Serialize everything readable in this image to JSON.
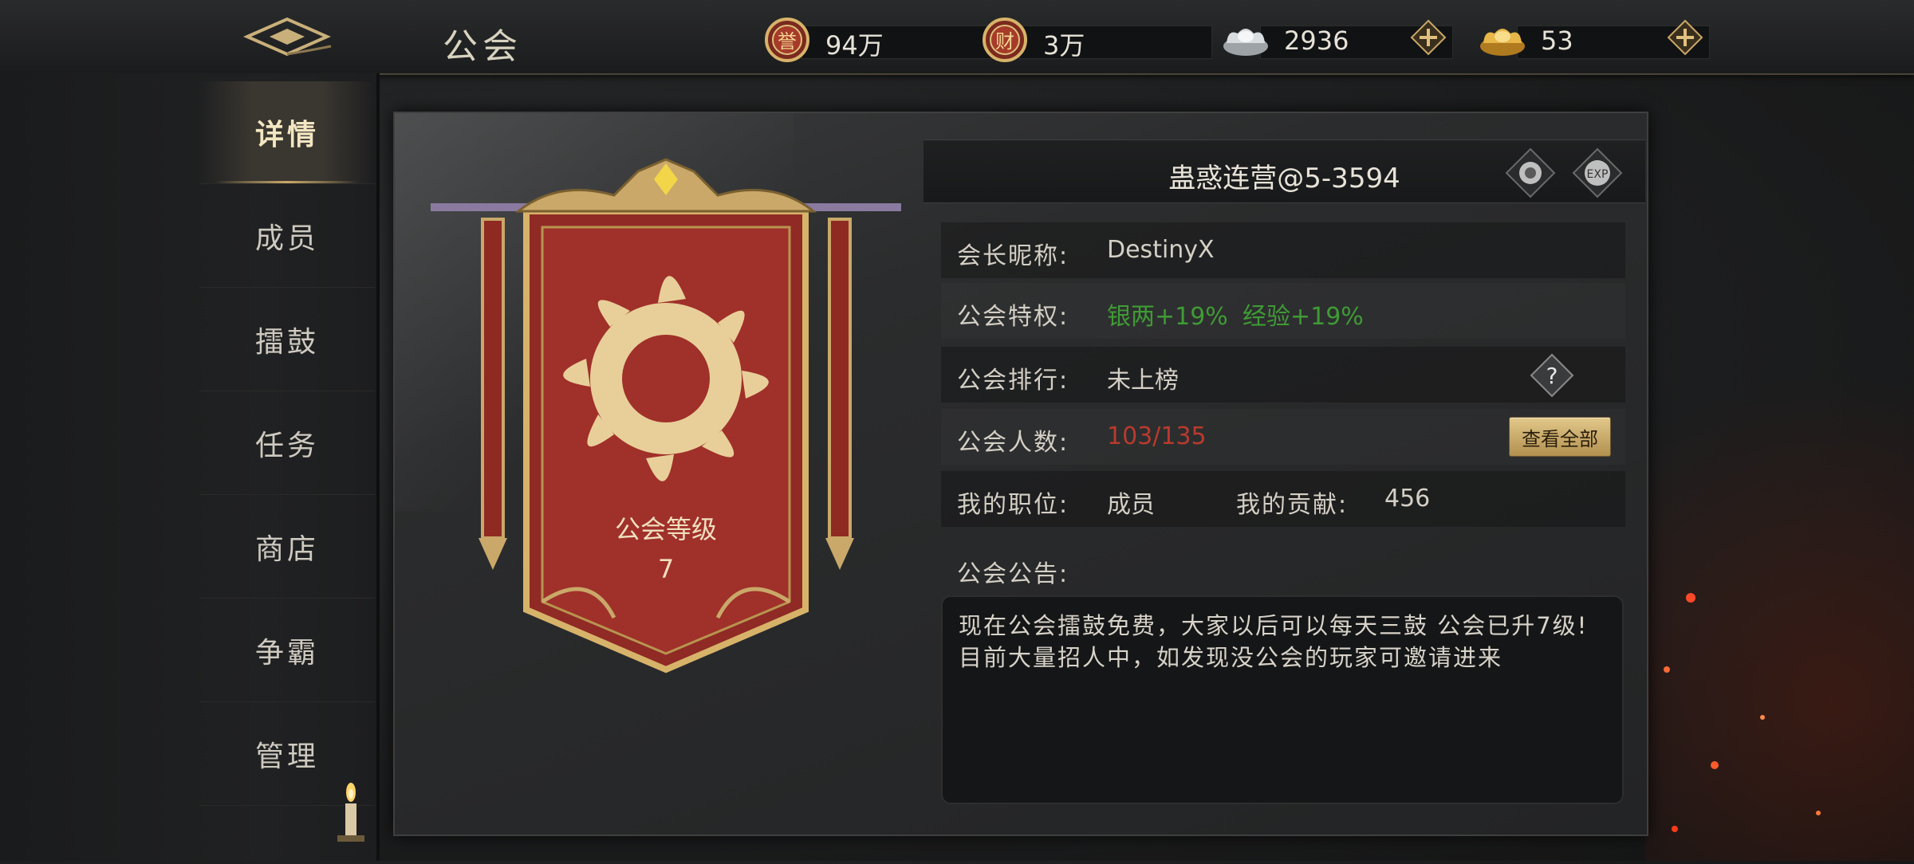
{
  "header": {
    "title": "公会",
    "currencies": [
      {
        "name": "reputation",
        "icon": "reputation-coin-icon",
        "icon_char": "誉",
        "value": "94万",
        "has_plus": false
      },
      {
        "name": "wealth",
        "icon": "wealth-coin-icon",
        "icon_char": "财",
        "value": "3万",
        "has_plus": false
      },
      {
        "name": "silver",
        "icon": "silver-ingot-icon",
        "value": "2936",
        "has_plus": true
      },
      {
        "name": "gold",
        "icon": "gold-ingot-icon",
        "value": "53",
        "has_plus": true
      }
    ]
  },
  "sidebar": {
    "items": [
      {
        "label": "详情",
        "active": true
      },
      {
        "label": "成员",
        "active": false
      },
      {
        "label": "擂鼓",
        "active": false
      },
      {
        "label": "任务",
        "active": false
      },
      {
        "label": "商店",
        "active": false
      },
      {
        "label": "争霸",
        "active": false
      },
      {
        "label": "管理",
        "active": false
      }
    ]
  },
  "banner": {
    "level_label": "公会等级",
    "level": "7"
  },
  "guild": {
    "name": "蛊惑连营@5-3594",
    "leader_label": "会长昵称:",
    "leader": "DestinyX",
    "privilege_label": "公会特权:",
    "privilege_silver": "银两+19%",
    "privilege_exp": "经验+19%",
    "rank_label": "公会排行:",
    "rank": "未上榜",
    "members_label": "公会人数:",
    "members": "103/135",
    "view_all": "查看全部",
    "position_label": "我的职位:",
    "position": "成员",
    "contribution_label": "我的贡献:",
    "contribution": "456",
    "notice_label": "公会公告:",
    "notice": "现在公会擂鼓免费，大家以后可以每天三鼓 公会已升7级! 目前大量招人中，如发现没公会的玩家可邀请进来"
  },
  "colors": {
    "accent_gold": "#c9a869",
    "privilege_green": "#3f9b35",
    "members_red": "#b83a2e"
  }
}
